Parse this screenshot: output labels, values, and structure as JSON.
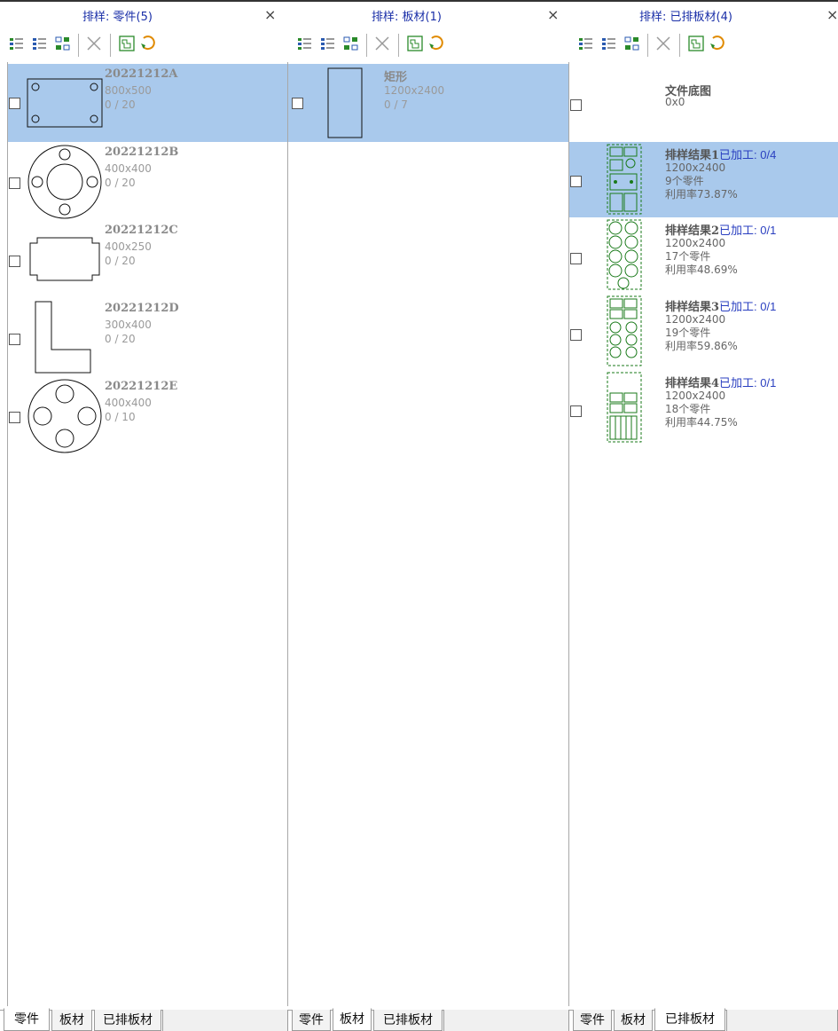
{
  "colors": {
    "selection": "#a9c9ec",
    "title": "#1a2fa8",
    "processed": "#2a3fc0",
    "nest_green": "#1a7a1a"
  },
  "toolbar_icons": [
    "list-detail-icon",
    "list-compact-icon",
    "group-icon",
    "delete-icon",
    "nest-icon",
    "refresh-icon"
  ],
  "tabs": [
    "零件",
    "板材",
    "已排板材"
  ],
  "panels": [
    {
      "title": "排样: 零件(5)",
      "close": "×",
      "items": [
        {
          "name": "20221212A",
          "size": "800x500",
          "count": "0 / 20"
        },
        {
          "name": "20221212B",
          "size": "400x400",
          "count": "0 / 20"
        },
        {
          "name": "20221212C",
          "size": "400x250",
          "count": "0 / 20"
        },
        {
          "name": "20221212D",
          "size": "300x400",
          "count": "0 / 20"
        },
        {
          "name": "20221212E",
          "size": "400x400",
          "count": "0 / 10"
        }
      ]
    },
    {
      "title": "排样: 板材(1)",
      "close": "×",
      "items": [
        {
          "name": "矩形",
          "size": "1200x2400",
          "count": "0 / 7"
        }
      ]
    },
    {
      "title": "排样: 已排板材(4)",
      "close": "×",
      "base": {
        "name": "文件底图",
        "size": "0x0"
      },
      "results": [
        {
          "name": "排样结果1",
          "done": "已加工: 0/4",
          "size": "1200x2400",
          "parts": "9个零件",
          "util": "利用率73.87%"
        },
        {
          "name": "排样结果2",
          "done": "已加工: 0/1",
          "size": "1200x2400",
          "parts": "17个零件",
          "util": "利用率48.69%"
        },
        {
          "name": "排样结果3",
          "done": "已加工: 0/1",
          "size": "1200x2400",
          "parts": "19个零件",
          "util": "利用率59.86%"
        },
        {
          "name": "排样结果4",
          "done": "已加工: 0/1",
          "size": "1200x2400",
          "parts": "18个零件",
          "util": "利用率44.75%"
        }
      ]
    }
  ]
}
